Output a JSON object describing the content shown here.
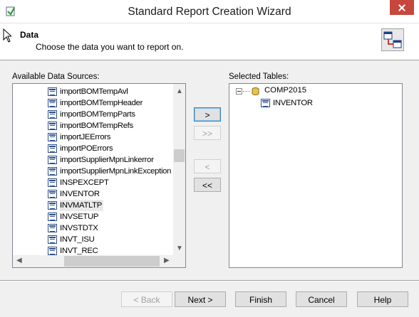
{
  "window": {
    "title": "Standard Report Creation Wizard"
  },
  "header": {
    "title": "Data",
    "subtitle": "Choose the data you want to report on."
  },
  "available": {
    "label": "Available Data Sources:",
    "items": [
      "importBOMTempAvl",
      "importBOMTempHeader",
      "importBOMTempParts",
      "importBOMTempRefs",
      "importJEErrors",
      "importPOErrors",
      "importSupplierMpnLinkerror",
      "importSupplierMpnLinkException",
      "INSPEXCEPT",
      "INVENTOR",
      "INVMATLTP",
      "INVSETUP",
      "INVSTDTX",
      "INVT_ISU",
      "INVT_REC"
    ],
    "highlighted_item": "INVMATLTP"
  },
  "transfer": {
    "add_one": ">",
    "add_all": ">>",
    "remove_one": "<",
    "remove_all": "<<"
  },
  "selected": {
    "label": "Selected Tables:",
    "database": "COMP2015",
    "tables": [
      "INVENTOR"
    ]
  },
  "footer": {
    "back": "< Back",
    "next": "Next >",
    "finish": "Finish",
    "cancel": "Cancel",
    "help": "Help"
  },
  "icons": {
    "app": "wizard-app-icon",
    "header": "database-link-icon",
    "table": "table-icon",
    "database": "database-icon",
    "close": "close-icon"
  },
  "colors": {
    "close": "#c7473c",
    "focus": "#3c7fb1",
    "icon_blue": "#2e4f8a"
  }
}
